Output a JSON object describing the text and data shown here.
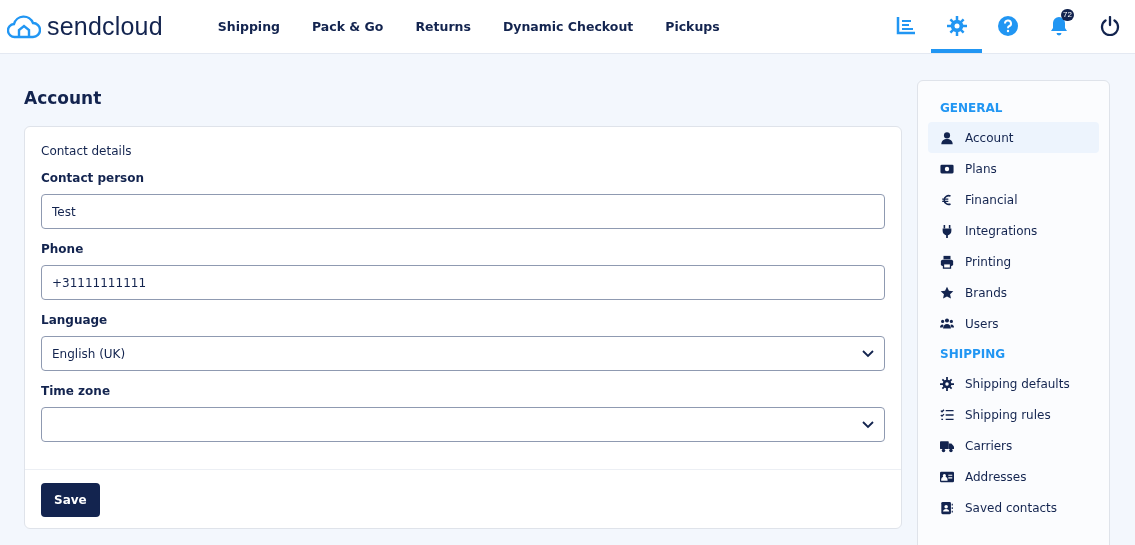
{
  "header": {
    "logo": "sendcloud",
    "nav": [
      {
        "label": "Shipping"
      },
      {
        "label": "Pack & Go"
      },
      {
        "label": "Returns"
      },
      {
        "label": "Dynamic Checkout"
      },
      {
        "label": "Pickups"
      }
    ],
    "actions": [
      {
        "kind": "analytics",
        "selected": false
      },
      {
        "kind": "settings",
        "selected": true
      },
      {
        "kind": "help",
        "selected": false
      },
      {
        "kind": "notifications",
        "selected": false,
        "badge": "72"
      },
      {
        "kind": "logout",
        "selected": false
      }
    ]
  },
  "page": {
    "title": "Account",
    "section": "Contact details",
    "fields": [
      {
        "kind": "text",
        "label": "Contact person",
        "value": "Test"
      },
      {
        "kind": "text",
        "label": "Phone",
        "value": "+31111111111"
      },
      {
        "kind": "select",
        "label": "Language",
        "value": "English (UK)"
      },
      {
        "kind": "select",
        "label": "Time zone"
      }
    ],
    "save": "Save"
  },
  "sidebar": {
    "groups": [
      {
        "title": "GENERAL",
        "items": [
          {
            "label": "Account",
            "selected": true
          },
          {
            "label": "Plans",
            "selected": false
          },
          {
            "label": "Financial",
            "selected": false
          },
          {
            "label": "Integrations",
            "selected": false
          },
          {
            "label": "Printing",
            "selected": false
          },
          {
            "label": "Brands",
            "selected": false
          },
          {
            "label": "Users",
            "selected": false
          }
        ]
      },
      {
        "title": "SHIPPING",
        "items": [
          {
            "label": "Shipping defaults",
            "selected": false
          },
          {
            "label": "Shipping rules",
            "selected": false
          },
          {
            "label": "Carriers",
            "selected": false
          },
          {
            "label": "Addresses",
            "selected": false
          },
          {
            "label": "Saved contacts",
            "selected": false
          }
        ]
      }
    ]
  }
}
